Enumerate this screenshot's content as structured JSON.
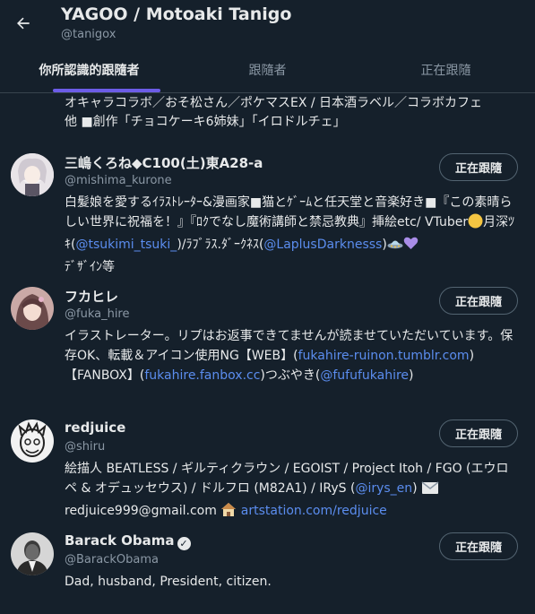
{
  "header": {
    "title": "YAGOO / Motoaki Tanigo",
    "handle": "@tanigox"
  },
  "tabs": [
    {
      "label": "你所認識的跟隨者"
    },
    {
      "label": "跟隨者"
    },
    {
      "label": "正在跟隨"
    }
  ],
  "bio_fragment": {
    "line1": "オキャラコラボ／おそ松さん／ポケマスEX / 日本酒ラベル／コラボカフェ",
    "line2": "他 ■創作「チョコケーキ6姉妹」「イロドルチェ」"
  },
  "users": [
    {
      "name": "三嶋くろね◆C100(土)東A28-a",
      "handle": "@mishima_kurone",
      "button": "正在跟隨",
      "bio": {
        "t1": "白髪娘を愛するｲﾗｽﾄﾚｰﾀｰ&漫画家■猫とｹﾞｰﾑと任天堂と音楽好き■『この素晴らしい世界に祝福を！』『ﾛｸでなし魔術講師と禁忌教典』挿絵etc/ VTuber",
        "t2": "月深ﾂｷ(",
        "l1": "@tsukimi_tsuki_",
        "t3": ")/ﾗﾌﾞﾗｽ.ﾀﾞｰｸﾈｽ(",
        "l2": "@LaplusDarknesss",
        "t4": ")",
        "t5": "ﾃﾞｻﾞｲﾝ等"
      }
    },
    {
      "name": "フカヒレ",
      "handle": "@fuka_hire",
      "button": "正在跟隨",
      "bio": {
        "t1": "イラストレーター。リプはお返事できてませんが読ませていただいています。保存OK、転載＆アイコン使用NG【WEB】(",
        "l1": "fukahire-ruinon.tumblr.com",
        "t2": ")【FANBOX】(",
        "l2": "fukahire.fanbox.cc",
        "t3": ")つぶやき(",
        "l3": "@fufufukahire",
        "t4": ")"
      }
    },
    {
      "name": "redjuice",
      "handle": "@shiru",
      "button": "正在跟隨",
      "bio": {
        "t1": "絵描人 BEATLESS / ギルティクラウン / EGOIST / Project Itoh / FGO (エウロペ & オデュッセウス) / ドルフロ (M82A1) / IRyS (",
        "l1": "@irys_en",
        "t2": ")",
        "t3": "redjuice999@gmail.com",
        "l2": "artstation.com/redjuice"
      }
    },
    {
      "name": "Barack Obama",
      "handle": "@BarackObama",
      "button": "正在跟隨",
      "bio": {
        "t1": "Dad, husband, President, citizen."
      }
    }
  ],
  "colors": {
    "background": "#15202b",
    "text": "#e7e9ea",
    "secondary": "#8b98a5",
    "link": "#5b8def",
    "tab_indicator": "#6c5ce7"
  }
}
